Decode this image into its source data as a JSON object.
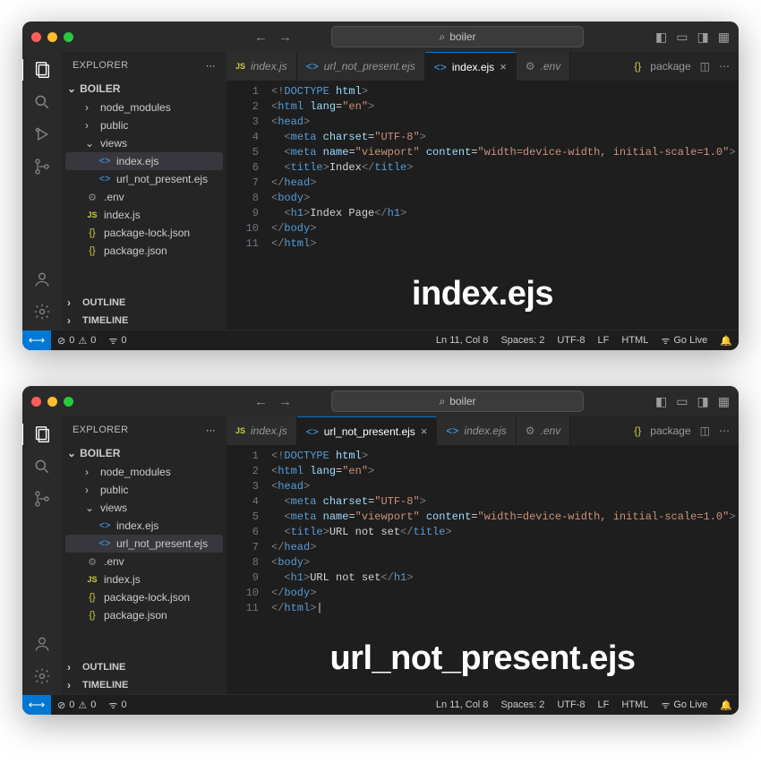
{
  "windows": [
    {
      "search": "boiler",
      "explorer_title": "EXPLORER",
      "root": "BOILER",
      "overlay": "index.ejs",
      "tree": {
        "node_modules": "node_modules",
        "public": "public",
        "views": "views",
        "index_ejs": "index.ejs",
        "url_ejs": "url_not_present.ejs",
        "env": ".env",
        "index_js": "index.js",
        "pkg_lock": "package-lock.json",
        "pkg": "package.json"
      },
      "selected": "index_ejs",
      "outline": "OUTLINE",
      "timeline": "TIMELINE",
      "tabs": {
        "t0": "index.js",
        "t1": "url_not_present.ejs",
        "t2": "index.ejs",
        "t3": ".env",
        "t4": "package"
      },
      "active_tab": "t2",
      "code_title": "Index",
      "code_h1": "Index Page",
      "status": {
        "errors": "0",
        "warnings": "0",
        "radio": "0",
        "pos": "Ln 11, Col 8",
        "spaces": "Spaces: 2",
        "enc": "UTF-8",
        "eol": "LF",
        "lang": "HTML",
        "golive": "Go Live"
      }
    },
    {
      "search": "boiler",
      "explorer_title": "EXPLORER",
      "root": "BOILER",
      "overlay": "url_not_present.ejs",
      "tree": {
        "node_modules": "node_modules",
        "public": "public",
        "views": "views",
        "index_ejs": "index.ejs",
        "url_ejs": "url_not_present.ejs",
        "env": ".env",
        "index_js": "index.js",
        "pkg_lock": "package-lock.json",
        "pkg": "package.json"
      },
      "selected": "url_ejs",
      "outline": "OUTLINE",
      "timeline": "TIMELINE",
      "tabs": {
        "t0": "index.js",
        "t1": "url_not_present.ejs",
        "t2": "index.ejs",
        "t3": ".env",
        "t4": "package"
      },
      "active_tab": "t1",
      "code_title": "URL not set",
      "code_h1": "URL not set",
      "status": {
        "errors": "0",
        "warnings": "0",
        "radio": "0",
        "pos": "Ln 11, Col 8",
        "spaces": "Spaces: 2",
        "enc": "UTF-8",
        "eol": "LF",
        "lang": "HTML",
        "golive": "Go Live"
      }
    }
  ]
}
